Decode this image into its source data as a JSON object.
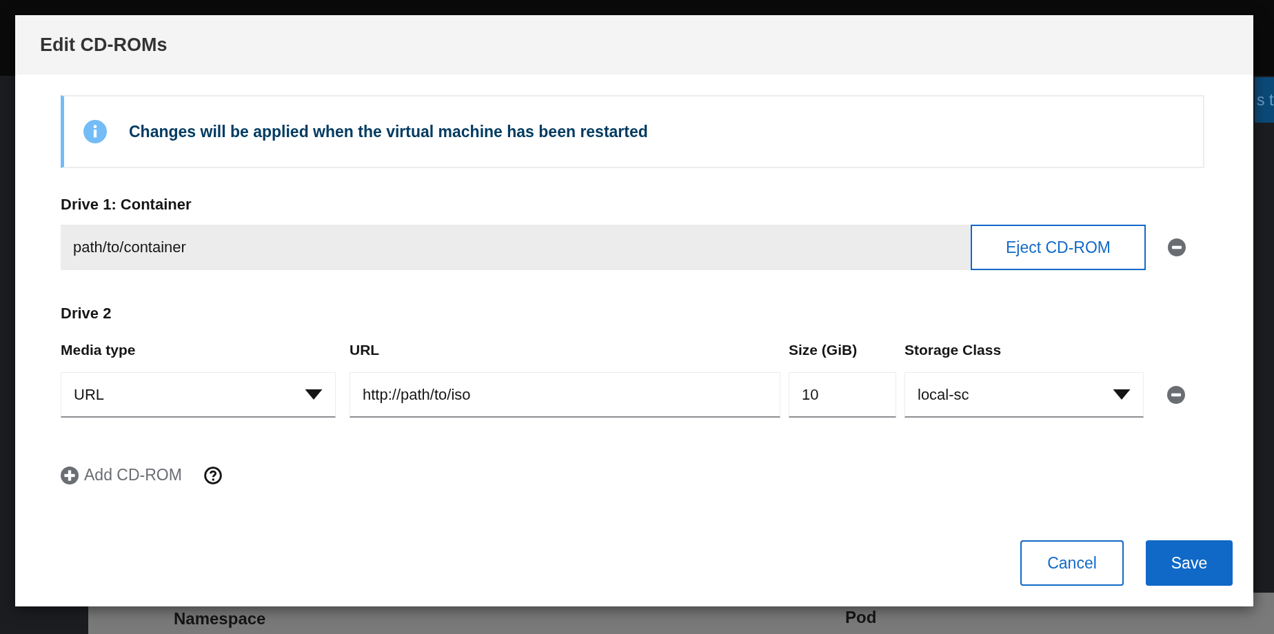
{
  "background": {
    "button_text": "s t",
    "labels": [
      "Namespace",
      "Pod"
    ]
  },
  "modal": {
    "title": "Edit CD-ROMs",
    "alert": {
      "kind": "info",
      "text": "Changes will be applied when the virtual machine has been restarted"
    },
    "drives": [
      {
        "kind": "container",
        "title": "Drive 1: Container",
        "value": "path/to/container",
        "eject_label": "Eject CD-ROM"
      },
      {
        "kind": "new",
        "title": "Drive 2",
        "fields": [
          {
            "kind": "select",
            "label": "Media type",
            "value": "URL"
          },
          {
            "kind": "text",
            "label": "URL",
            "value": "http://path/to/iso"
          },
          {
            "kind": "text",
            "label": "Size (GiB)",
            "value": "10"
          },
          {
            "kind": "select",
            "label": "Storage Class",
            "value": "local-sc"
          }
        ]
      }
    ],
    "add_label": "Add CD-ROM",
    "buttons": [
      {
        "kind": "secondary",
        "label": "Cancel"
      },
      {
        "kind": "primary",
        "label": "Save"
      }
    ]
  }
}
